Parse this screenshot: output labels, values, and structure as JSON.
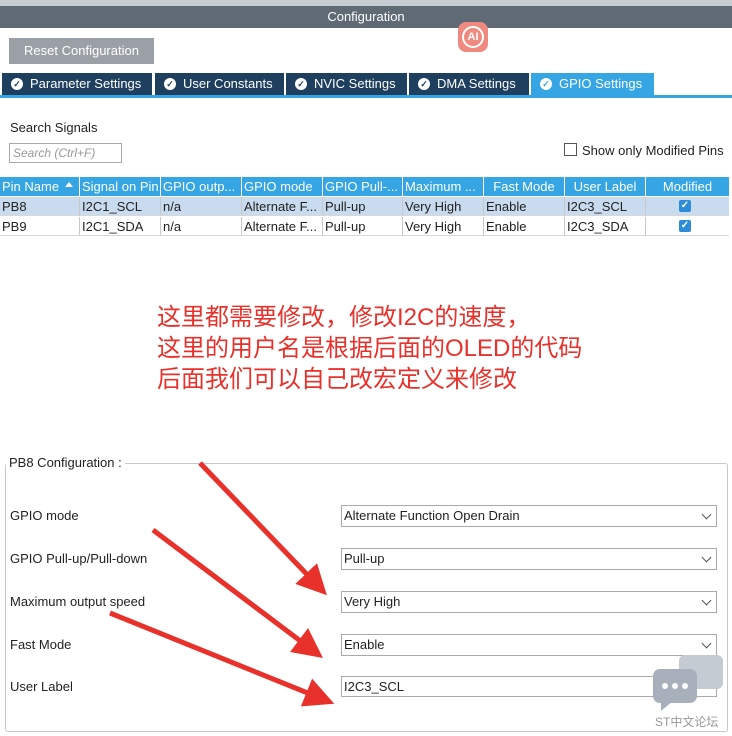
{
  "window": {
    "title": "Configuration"
  },
  "toolbar": {
    "reset_label": "Reset Configuration"
  },
  "badge": {
    "ai_label": "AI"
  },
  "tabs": [
    {
      "label": "Parameter Settings",
      "icon": "check-circle-icon"
    },
    {
      "label": "User Constants",
      "icon": "check-circle-icon"
    },
    {
      "label": "NVIC Settings",
      "icon": "check-circle-icon"
    },
    {
      "label": "DMA Settings",
      "icon": "check-circle-icon"
    },
    {
      "label": "GPIO Settings",
      "icon": "check-circle-icon",
      "active": true
    }
  ],
  "search": {
    "label": "Search Signals",
    "placeholder": "Search (Ctrl+F)",
    "value": ""
  },
  "filter": {
    "show_modified_label": "Show only Modified Pins",
    "checked": false
  },
  "table": {
    "columns": [
      "Pin Name",
      "Signal on Pin",
      "GPIO outp...",
      "GPIO mode",
      "GPIO Pull-...",
      "Maximum ...",
      "Fast Mode",
      "User Label",
      "Modified"
    ],
    "rows": [
      {
        "cells": [
          "PB8",
          "I2C1_SCL",
          "n/a",
          "Alternate F...",
          "Pull-up",
          "Very High",
          "Enable",
          "I2C3_SCL"
        ],
        "modified": true,
        "selected": true
      },
      {
        "cells": [
          "PB9",
          "I2C1_SDA",
          "n/a",
          "Alternate F...",
          "Pull-up",
          "Very High",
          "Enable",
          "I2C3_SDA"
        ],
        "modified": true,
        "selected": false
      }
    ]
  },
  "annotation": {
    "lines": [
      "这里都需要修改，修改I2C的速度，",
      "这里的用户名是根据后面的OLED的代码",
      "后面我们可以自己改宏定义来修改"
    ],
    "color": "#e8312a"
  },
  "config": {
    "title": "PB8 Configuration :",
    "fields": [
      {
        "label": "GPIO mode",
        "value": "Alternate Function Open Drain",
        "type": "select"
      },
      {
        "label": "GPIO Pull-up/Pull-down",
        "value": "Pull-up",
        "type": "select"
      },
      {
        "label": "Maximum output speed",
        "value": "Very High",
        "type": "select"
      },
      {
        "label": "Fast Mode",
        "value": "Enable",
        "type": "select"
      },
      {
        "label": "User Label",
        "value": "I2C3_SCL",
        "type": "text"
      }
    ]
  },
  "watermark": {
    "text": "ST中文论坛"
  },
  "colors": {
    "accent": "#35a5e3",
    "tab_bg": "#1f3f5f",
    "title_bg": "#5f6a75",
    "selected_row": "#c9dbef"
  }
}
